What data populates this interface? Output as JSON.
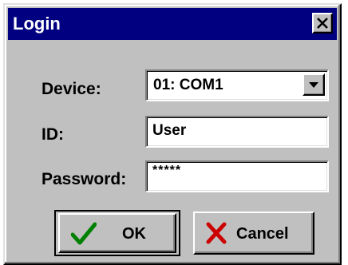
{
  "window": {
    "title": "Login",
    "title_bar_color": "#000080",
    "close_icon": "close-icon"
  },
  "form": {
    "device_label": "Device:",
    "device_value": "01: COM1",
    "device_dropdown_icon": "chevron-down-icon",
    "id_label": "ID:",
    "id_value": "User",
    "password_label": "Password:",
    "password_value": "*****"
  },
  "buttons": {
    "ok_label": "OK",
    "ok_icon": "checkmark-icon",
    "ok_icon_color": "#008000",
    "cancel_label": "Cancel",
    "cancel_icon": "x-icon",
    "cancel_icon_color": "#cc0000"
  }
}
